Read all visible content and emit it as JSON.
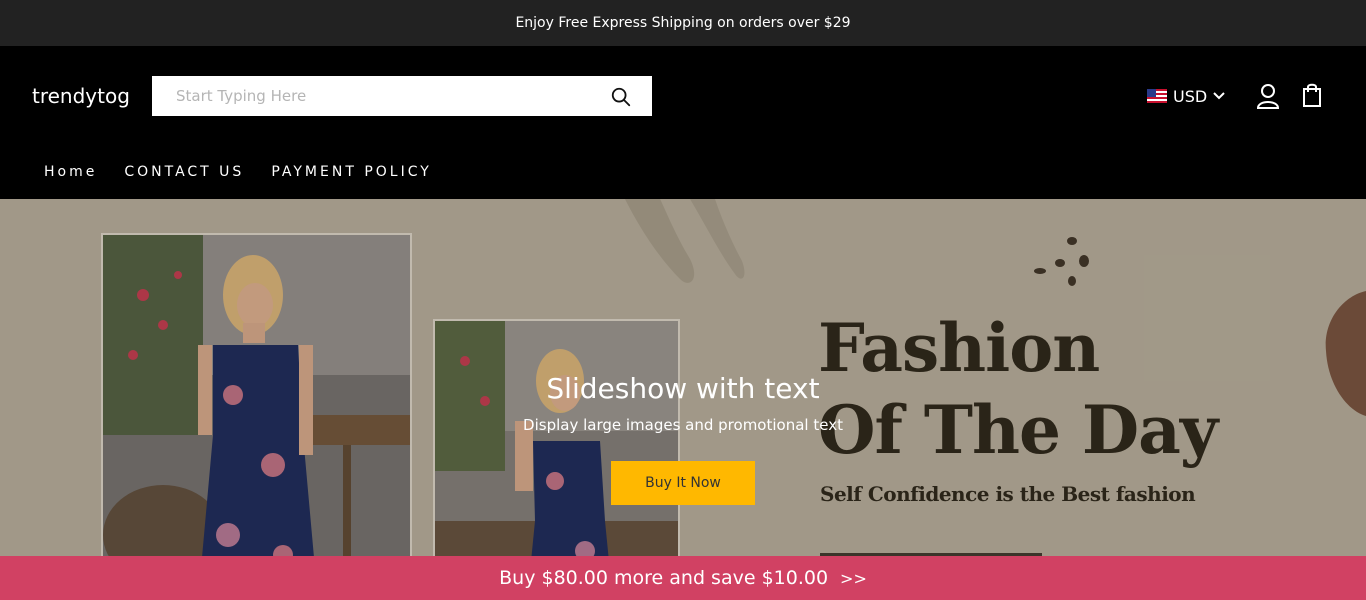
{
  "announcement": {
    "text": "Enjoy Free Express Shipping on orders over $29"
  },
  "header": {
    "logo": "trendytog",
    "search": {
      "placeholder": "Start Typing Here",
      "value": "",
      "icon": "search-icon"
    },
    "currency": {
      "label": "USD",
      "flag": "us-flag-icon"
    },
    "account_icon": "user-icon",
    "cart_icon": "shopping-bag-icon"
  },
  "nav": {
    "items": [
      {
        "label": "Home"
      },
      {
        "label": "CONTACT US"
      },
      {
        "label": "PAYMENT POLICY"
      }
    ]
  },
  "hero": {
    "title": "Slideshow with text",
    "subtitle": "Display large images and promotional text",
    "button_label": "Buy It Now",
    "banner": {
      "line1": "Fashion",
      "line2": "Of The Day",
      "line3": "Self Confidence is the Best fashion"
    }
  },
  "promo_bar": {
    "text": "Buy $80.00 more and save $10.00",
    "arrows": ">>"
  },
  "colors": {
    "announcement_bg": "#222222",
    "header_bg": "#000000",
    "hero_bg": "#a89f8e",
    "button_bg": "#ffb800",
    "promo_bg": "#d14163"
  }
}
